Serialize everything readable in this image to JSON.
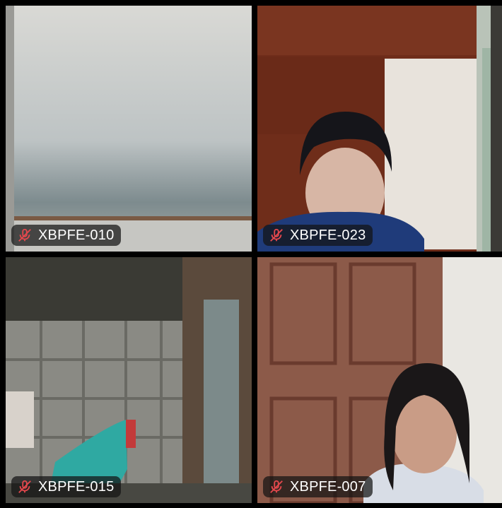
{
  "participants": [
    {
      "name": "XBPFE-010",
      "muted": true
    },
    {
      "name": "XBPFE-023",
      "muted": true
    },
    {
      "name": "XBPFE-015",
      "muted": true
    },
    {
      "name": "XBPFE-007",
      "muted": true
    }
  ],
  "colors": {
    "muted_icon": "#e5484d",
    "label_text": "#ffffff",
    "background": "#000000"
  },
  "icons": {
    "muted": "microphone-muted-icon"
  }
}
